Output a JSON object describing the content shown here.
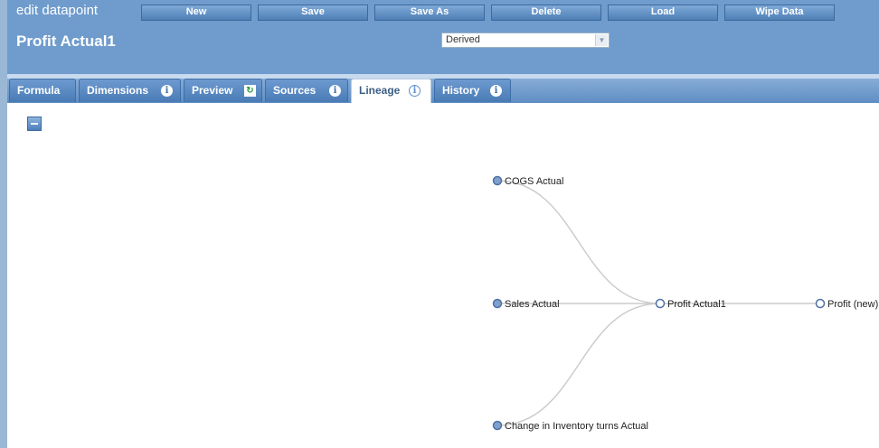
{
  "header": {
    "app_title": "edit datapoint",
    "page_title": "Profit Actual1",
    "type_select": "Derived"
  },
  "toolbar": {
    "new": "New",
    "save": "Save",
    "save_as": "Save As",
    "delete": "Delete",
    "load": "Load",
    "wipe": "Wipe Data"
  },
  "tabs": [
    {
      "label": "Formula",
      "icon": ""
    },
    {
      "label": "Dimensions",
      "icon": "info-icon"
    },
    {
      "label": "Preview",
      "icon": "refresh-icon"
    },
    {
      "label": "Sources",
      "icon": "info-icon"
    },
    {
      "label": "Lineage",
      "icon": "info-icon",
      "active": true
    },
    {
      "label": "History",
      "icon": "info-icon"
    }
  ],
  "lineage": {
    "sources": [
      "COGS Actual",
      "Sales Actual",
      "Change in Inventory turns Actual"
    ],
    "current": "Profit Actual1",
    "targets": [
      "Profit (new)"
    ]
  },
  "colors": {
    "header_bg": "#6f9ccd",
    "tab_bg": "#4a7bb5",
    "node_filled": "#7f9fcc",
    "edge": "#cccccc"
  }
}
